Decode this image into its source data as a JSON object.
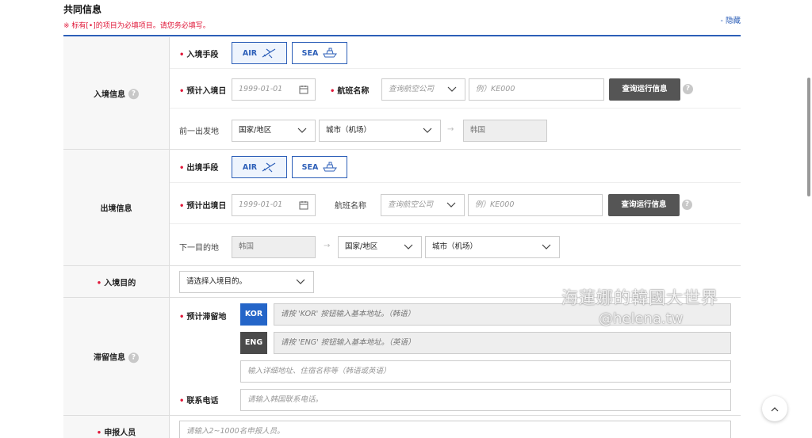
{
  "header": {
    "title": "共同信息",
    "notice": "※ 标有[•]的项目为必填项目。请您务必填写。",
    "hide": "- 隐藏"
  },
  "entry": {
    "label": "入境信息",
    "means_label": "入境手段",
    "air": "AIR",
    "sea": "SEA",
    "date_label": "预计入境日",
    "date_ph": "1999-01-01",
    "flight_label": "航班名称",
    "airline_ph": "查询航空公司",
    "flight_ph": "例）KE000",
    "query_btn": "查询运行信息",
    "origin_label": "前一出发地",
    "country": "国家/地区",
    "city": "城市（机场）",
    "dest": "韩国"
  },
  "exit": {
    "label": "出境信息",
    "means_label": "出境手段",
    "air": "AIR",
    "sea": "SEA",
    "date_label": "预计出境日",
    "date_ph": "1999-01-01",
    "flight_label": "航班名称",
    "airline_ph": "查询航空公司",
    "flight_ph": "例）KE000",
    "query_btn": "查询运行信息",
    "next_label": "下一目的地",
    "origin": "韩国",
    "country": "国家/地区",
    "city": "城市（机场）"
  },
  "purpose": {
    "label": "入境目的",
    "select": "请选择入境目的。"
  },
  "stay": {
    "label": "滞留信息",
    "addr_label": "预计滞留地",
    "kor": "KOR",
    "eng": "ENG",
    "kor_ph": "请按 'KOR' 按钮输入基本地址。（韩语）",
    "eng_ph": "请按 'ENG' 按钮输入基本地址。（英语）",
    "detail_ph": "输入详细地址、住宿名称等（韩语或英语）",
    "phone_label": "联系电话",
    "phone_ph": "请输入韩国联系电话。"
  },
  "reporter": {
    "label": "申报人员",
    "ph": "请输入2~1000名申报人员。"
  },
  "watermark": {
    "line1": "海蓮娜的韓國大世界",
    "line2": "@helena.tw"
  },
  "icons": [
    "airplane-icon",
    "ship-icon",
    "calendar-icon",
    "chevron-down-icon",
    "help-icon",
    "arrow-right-icon",
    "chevron-up-icon"
  ]
}
